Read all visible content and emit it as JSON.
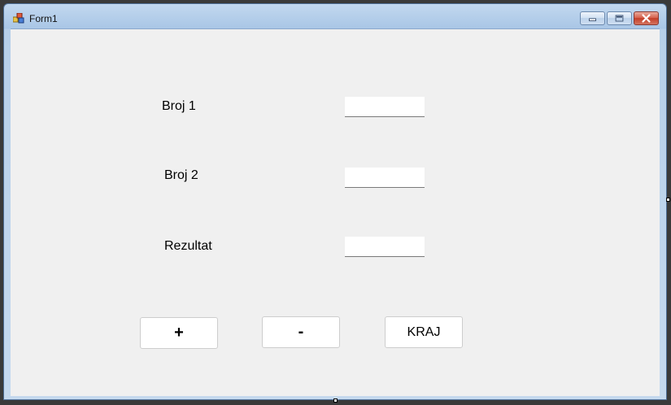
{
  "window": {
    "title": "Form1",
    "caption_buttons": {
      "minimize": "minimize-icon",
      "maximize": "maximize-icon",
      "close": "close-icon"
    }
  },
  "form": {
    "labels": {
      "broj1": "Broj 1",
      "broj2": "Broj 2",
      "rezultat": "Rezultat"
    },
    "inputs": {
      "broj1_value": "",
      "broj2_value": "",
      "rezultat_value": ""
    },
    "buttons": {
      "plus": "+",
      "minus": "-",
      "kraj": "KRAJ"
    }
  },
  "colors": {
    "client_bg": "#f0f0f0",
    "title_bar": "#a9c6e6",
    "close_button": "#c33e28"
  }
}
